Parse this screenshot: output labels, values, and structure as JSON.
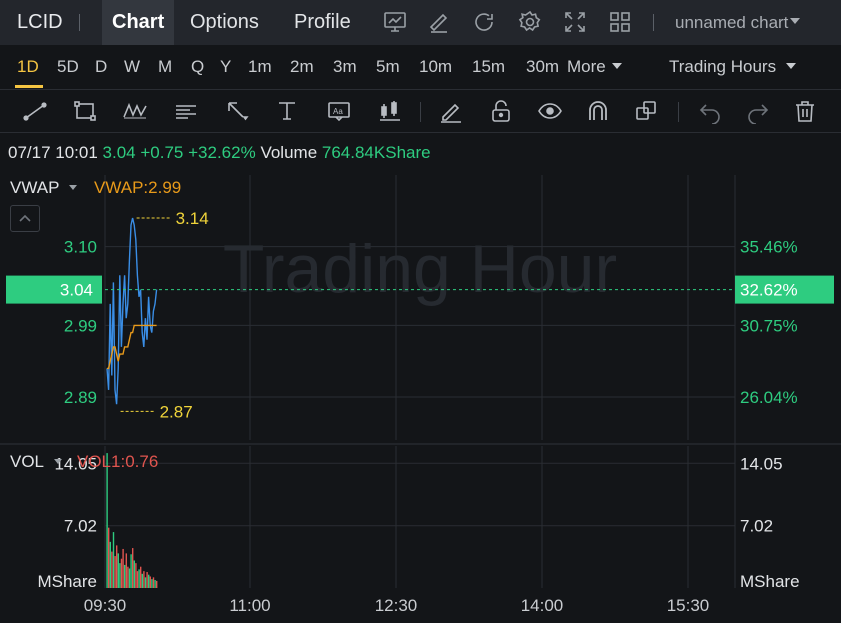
{
  "header": {
    "ticker": "LCID",
    "tabs": [
      "Chart",
      "Options",
      "Profile"
    ],
    "active_tab": "Chart",
    "icons": [
      "chart-screen-icon",
      "edit-icon",
      "refresh-icon",
      "settings-icon",
      "fullscreen-icon",
      "layout-grid-icon"
    ],
    "chart_name": "unnamed chart"
  },
  "intervals": {
    "items": [
      "1D",
      "5D",
      "D",
      "W",
      "M",
      "Q",
      "Y",
      "1m",
      "2m",
      "3m",
      "5m",
      "10m",
      "15m",
      "30m"
    ],
    "active": "1D",
    "more_label": "More",
    "session_label": "Trading Hours"
  },
  "toolbar": {
    "tools": [
      "trend-line-icon",
      "rectangle-icon",
      "pattern-icon",
      "text-note-icon",
      "arrow-icon",
      "price-range-icon",
      "label-icon",
      "candle-icon",
      "brush-icon",
      "lock-icon",
      "eye-icon",
      "magnet-icon",
      "layers-icon",
      "undo-icon",
      "redo-icon",
      "trash-icon"
    ]
  },
  "quote": {
    "datetime": "07/17 10:01",
    "price": "3.04",
    "change": "+0.75",
    "change_pct": "+32.62%",
    "volume_label": "Volume",
    "volume": "764.84KShare"
  },
  "chart_data": {
    "type": "line",
    "watermark": "Trading Hour",
    "price_panel": {
      "indicator": "VWAP",
      "indicator_value": "VWAP:2.99",
      "left_ticks": [
        "3.10",
        "2.99",
        "2.89"
      ],
      "right_ticks": [
        "35.46%",
        "30.75%",
        "26.04%"
      ],
      "current_price": "3.04",
      "current_pct": "32.62%",
      "high_label": "3.14",
      "low_label": "2.87",
      "ylim": [
        2.83,
        3.2
      ],
      "series": [
        {
          "name": "Price",
          "color": "#3a8ee6",
          "x": [
            0,
            1,
            2,
            3,
            4,
            5,
            6,
            7,
            8,
            9,
            10,
            11,
            12,
            13,
            14,
            15,
            16,
            17,
            18,
            19,
            20,
            21,
            22,
            23,
            24,
            25,
            26,
            27,
            28,
            29,
            30,
            31
          ],
          "values": [
            2.93,
            2.9,
            3.02,
            2.92,
            3.05,
            2.9,
            2.88,
            2.93,
            3.06,
            2.96,
            3.02,
            3.06,
            3.0,
            3.02,
            3.08,
            3.13,
            3.14,
            3.13,
            3.11,
            3.06,
            3.03,
            3.04,
            2.98,
            2.96,
            3.0,
            2.97,
            3.03,
            2.99,
            2.98,
            3.01,
            3.02,
            3.04
          ]
        },
        {
          "name": "VWAP",
          "color": "#e89a1a",
          "x": [
            0,
            1,
            2,
            3,
            4,
            5,
            6,
            7,
            8,
            9,
            10,
            11,
            12,
            13,
            14,
            15,
            16,
            17,
            18,
            19,
            20,
            21,
            22,
            23,
            24,
            25,
            26,
            27,
            28,
            29,
            30,
            31
          ],
          "values": [
            2.93,
            2.93,
            2.94,
            2.95,
            2.96,
            2.96,
            2.95,
            2.94,
            2.95,
            2.95,
            2.95,
            2.96,
            2.96,
            2.96,
            2.97,
            2.98,
            2.98,
            2.99,
            2.99,
            2.99,
            2.99,
            2.99,
            2.99,
            2.99,
            2.99,
            2.99,
            2.99,
            2.99,
            2.99,
            2.99,
            2.99,
            2.99
          ]
        }
      ]
    },
    "volume_panel": {
      "indicator": "VOL",
      "indicator_value": "VOL1:0.76",
      "left_ticks": [
        "14.05",
        "7.02"
      ],
      "right_ticks": [
        "14.05",
        "7.02"
      ],
      "unit": "MShare",
      "ylim": [
        0,
        16
      ],
      "values": [
        15.2,
        6.8,
        5.2,
        4.1,
        6.3,
        3.6,
        4.8,
        3.9,
        2.8,
        3.3,
        4.4,
        2.6,
        3.9,
        2.4,
        2.2,
        3.8,
        4.5,
        3.1,
        2.8,
        1.9,
        2.1,
        2.4,
        1.6,
        1.9,
        1.2,
        1.8,
        1.5,
        1.3,
        1.0,
        1.2,
        0.9,
        0.8
      ],
      "colors": [
        "up",
        "down",
        "up",
        "down",
        "up",
        "down",
        "down",
        "up",
        "up",
        "down",
        "down",
        "up",
        "down",
        "down",
        "up",
        "up",
        "down",
        "up",
        "down",
        "down",
        "up",
        "down",
        "up",
        "down",
        "up",
        "down",
        "up",
        "down",
        "up",
        "down",
        "up",
        "down"
      ]
    },
    "x_ticks": [
      "09:30",
      "11:00",
      "12:30",
      "14:00",
      "15:30"
    ],
    "colors": {
      "up": "#2ecc80",
      "down": "#e0554f",
      "highlow": "#f0d43a",
      "price_tag": "#2ecc80"
    }
  }
}
